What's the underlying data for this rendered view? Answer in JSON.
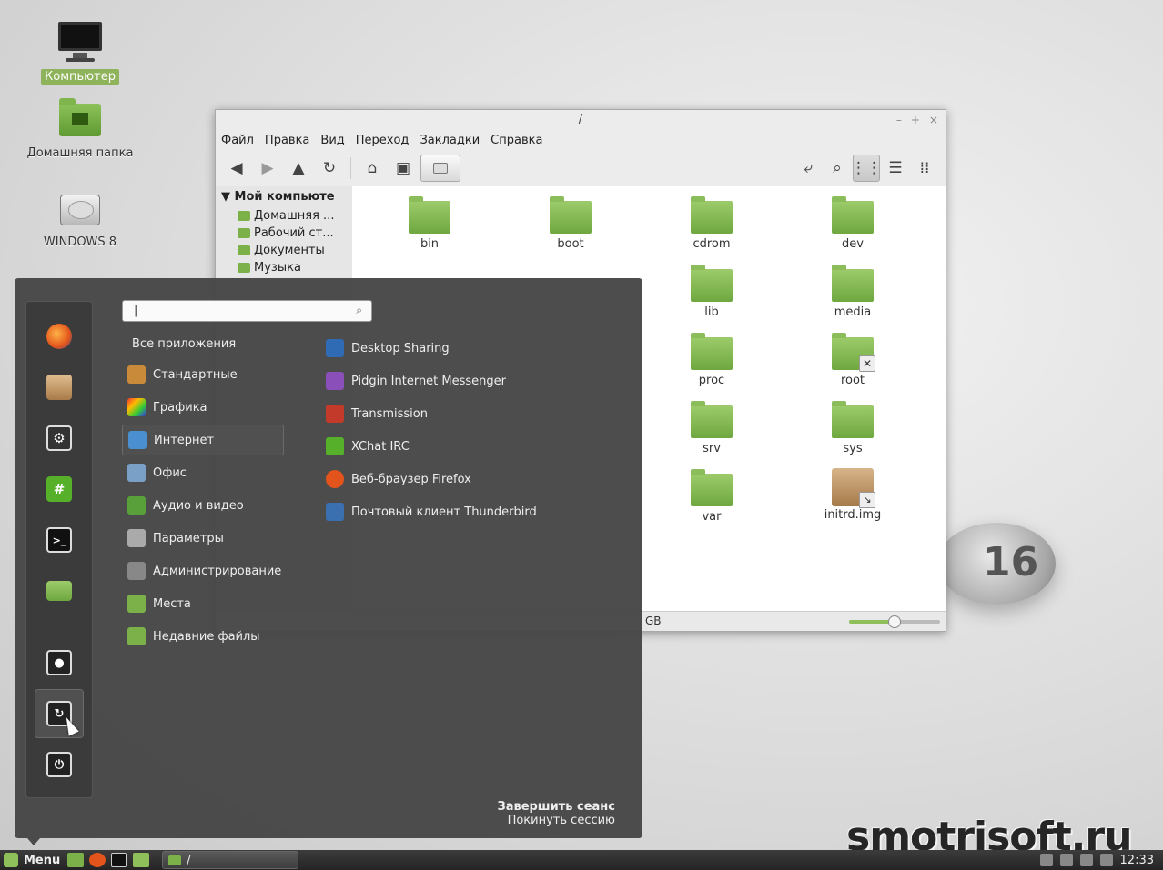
{
  "desktop": {
    "icons": [
      {
        "label": "Компьютер"
      },
      {
        "label": "Домашняя папка"
      },
      {
        "label": "WINDOWS 8"
      }
    ],
    "logo_number": "16"
  },
  "file_manager": {
    "title": "/",
    "window_controls": [
      "–",
      "+",
      "×"
    ],
    "menu": [
      "Файл",
      "Правка",
      "Вид",
      "Переход",
      "Закладки",
      "Справка"
    ],
    "sidebar": {
      "heading": "Мой компьюте",
      "items": [
        "Домашняя ...",
        "Рабочий ст...",
        "Документы",
        "Музыка"
      ]
    },
    "files": [
      {
        "name": "bin",
        "type": "folder"
      },
      {
        "name": "boot",
        "type": "folder"
      },
      {
        "name": "cdrom",
        "type": "folder"
      },
      {
        "name": "dev",
        "type": "folder"
      },
      {
        "name": "lib",
        "type": "folder"
      },
      {
        "name": "media",
        "type": "folder"
      },
      {
        "name": "proc",
        "type": "folder"
      },
      {
        "name": "root",
        "type": "folder-locked"
      },
      {
        "name": "srv",
        "type": "folder"
      },
      {
        "name": "sys",
        "type": "folder"
      },
      {
        "name": "var",
        "type": "folder"
      },
      {
        "name": "initrd.img",
        "type": "link"
      }
    ],
    "status_free": "GB",
    "zoom_level": 0.5
  },
  "start_menu": {
    "search_value": "|",
    "all_apps": "Все приложения",
    "categories": [
      {
        "label": "Стандартные",
        "color": "#c98a3a"
      },
      {
        "label": "Графика",
        "color": "#d64fb0"
      },
      {
        "label": "Интернет",
        "color": "#4a8fd0"
      },
      {
        "label": "Офис",
        "color": "#7aa0c8"
      },
      {
        "label": "Аудио и видео",
        "color": "#5aa03a"
      },
      {
        "label": "Параметры",
        "color": "#aaaaaa"
      },
      {
        "label": "Администрирование",
        "color": "#888888"
      },
      {
        "label": "Места",
        "color": "#7cb14a"
      },
      {
        "label": "Недавние файлы",
        "color": "#7cb14a"
      }
    ],
    "selected_category": "Интернет",
    "apps": [
      {
        "label": "Desktop Sharing",
        "color": "#2f6bb5"
      },
      {
        "label": "Pidgin Internet Messenger",
        "color": "#8a4fb8"
      },
      {
        "label": "Transmission",
        "color": "#c33a2a"
      },
      {
        "label": "XChat IRC",
        "color": "#57b02a"
      },
      {
        "label": "Веб-браузер Firefox",
        "color": "#e2541b"
      },
      {
        "label": "Почтовый клиент Thunderbird",
        "color": "#3a6fb0"
      }
    ],
    "favorites": [
      "firefox-icon",
      "package-manager-icon",
      "system-settings-icon",
      "xchat-icon",
      "terminal-icon",
      "files-icon",
      "lock-screen-icon",
      "logout-icon",
      "shutdown-icon"
    ],
    "session_title": "Завершить сеанс",
    "session_subtitle": "Покинуть сессию"
  },
  "taskbar": {
    "menu_label": "Menu",
    "window_label": "/",
    "clock": "12:33"
  },
  "watermark": "smotrisoft.ru"
}
